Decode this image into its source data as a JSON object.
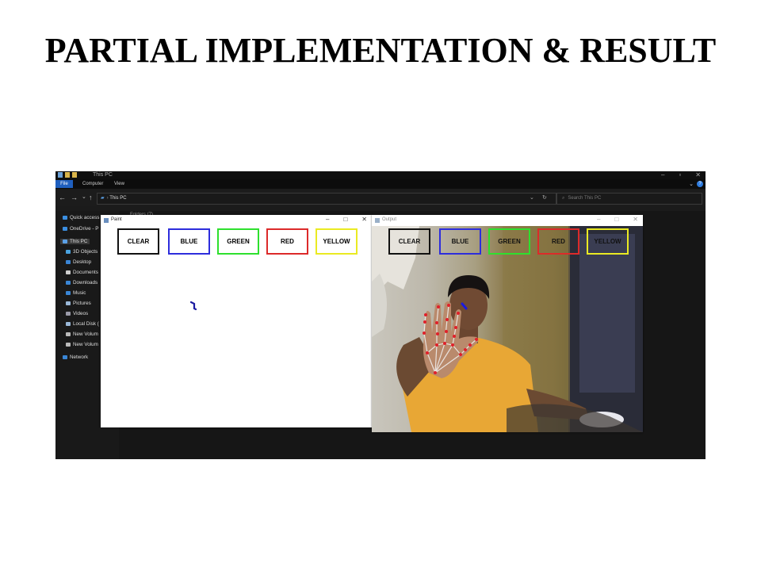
{
  "slide": {
    "title": "PARTIAL IMPLEMENTATION & RESULT"
  },
  "explorer": {
    "title": "This PC",
    "ribbon_tabs": [
      "File",
      "Computer",
      "View"
    ],
    "address": "This PC",
    "search_placeholder": "Search This PC",
    "folders_heading": "Folders (7)",
    "nav_items": [
      {
        "label": "Quick access",
        "icon": "star-icon",
        "color": "#3b8ee0"
      },
      {
        "label": "OneDrive - P",
        "icon": "cloud-icon",
        "color": "#3b8ee0"
      },
      {
        "label": "This PC",
        "icon": "computer-icon",
        "color": "#5aa0e6"
      },
      {
        "label": "3D Objects",
        "icon": "cube-icon",
        "color": "#4aa3e0"
      },
      {
        "label": "Desktop",
        "icon": "desktop-icon",
        "color": "#3a86d6"
      },
      {
        "label": "Documents",
        "icon": "document-icon",
        "color": "#cfcfcf"
      },
      {
        "label": "Downloads",
        "icon": "download-icon",
        "color": "#3a86d6"
      },
      {
        "label": "Music",
        "icon": "music-icon",
        "color": "#3a86d6"
      },
      {
        "label": "Pictures",
        "icon": "pictures-icon",
        "color": "#9ab8d8"
      },
      {
        "label": "Videos",
        "icon": "videos-icon",
        "color": "#9a9aa8"
      },
      {
        "label": "Local Disk (",
        "icon": "disk-icon",
        "color": "#9ab8d8"
      },
      {
        "label": "New Volum",
        "icon": "drive-icon",
        "color": "#bbbbbb"
      },
      {
        "label": "New Volum",
        "icon": "drive-icon",
        "color": "#bbbbbb"
      },
      {
        "label": "Network",
        "icon": "network-icon",
        "color": "#3a86d6"
      }
    ]
  },
  "paint_window": {
    "title": "Paint",
    "buttons": [
      "CLEAR",
      "BLUE",
      "GREEN",
      "RED",
      "YELLOW"
    ],
    "button_colors": [
      "#111111",
      "#2d2ddc",
      "#2ee02e",
      "#dc2a2a",
      "#eaea22"
    ],
    "stroke_color": "#1a1aa0"
  },
  "output_window": {
    "title": "Output",
    "buttons": [
      "CLEAR",
      "BLUE",
      "GREEN",
      "RED",
      "YELLOW"
    ],
    "landmark_color": "#e0202a"
  }
}
